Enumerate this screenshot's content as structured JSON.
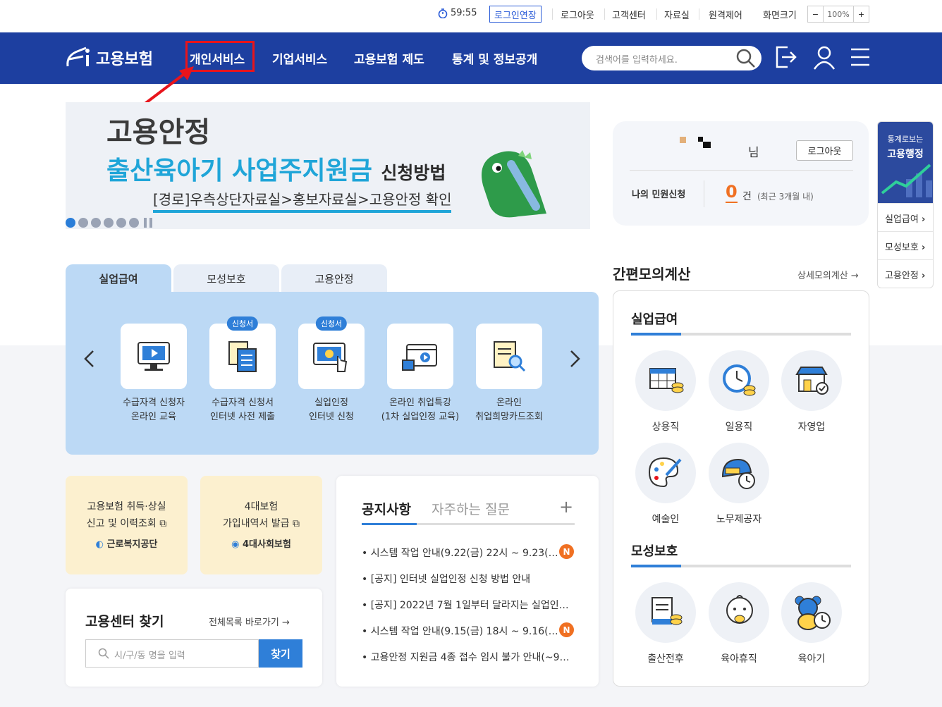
{
  "utility": {
    "timer": "59:55",
    "extend_label": "로그인연장",
    "logout": "로그아웃",
    "customer_center": "고객센터",
    "archive": "자료실",
    "remote": "원격제어",
    "screen_size": "화면크기",
    "zoom_minus": "−",
    "zoom_value": "100%",
    "zoom_plus": "+"
  },
  "header": {
    "logo_text": "고용보험",
    "nav": [
      "개인서비스",
      "기업서비스",
      "고용보험 제도",
      "통계 및 정보공개"
    ],
    "search_placeholder": "검색어를 입력하세요."
  },
  "banner": {
    "line1": "고용안정",
    "line2": "출산육아기 사업주지원금",
    "line2_suffix": "신청방법",
    "line3": "[경로]우측상단자료실>홍보자료실>고용안정 확인"
  },
  "user": {
    "suffix": "님",
    "logout_label": "로그아웃",
    "my_request_label": "나의 민원신청",
    "count": "0",
    "count_unit": "건",
    "count_note": "(최근 3개월 내)"
  },
  "side": {
    "top_small": "통계로보는",
    "top_big": "고용행정",
    "links": [
      "실업급여",
      "모성보호",
      "고용안정"
    ]
  },
  "tabs": [
    "실업급여",
    "모성보호",
    "고용안정"
  ],
  "services": [
    {
      "line1": "수급자격 신청자",
      "line2": "온라인 교육",
      "badge": ""
    },
    {
      "line1": "수급자격 신청서",
      "line2": "인터넷 사전 제출",
      "badge": "신청서"
    },
    {
      "line1": "실업인정",
      "line2": "인터넷 신청",
      "badge": "신청서"
    },
    {
      "line1": "온라인 취업특강",
      "line2": "(1차 실업인정 교육)",
      "badge": ""
    },
    {
      "line1": "온라인",
      "line2": "취업희망카드조회",
      "badge": ""
    }
  ],
  "cards": [
    {
      "line1": "고용보험 취득·상실",
      "line2": "신고 및 이력조회",
      "org": "근로복지공단"
    },
    {
      "line1": "4대보험",
      "line2": "가입내역서 발급",
      "org": "4대사회보험"
    }
  ],
  "finder": {
    "title": "고용센터 찾기",
    "link": "전체목록 바로가기",
    "placeholder": "시/구/동 명을 입력",
    "button": "찾기"
  },
  "notice": {
    "tab_active": "공지사항",
    "tab_other": "자주하는 질문",
    "plus": "+",
    "items": [
      {
        "text": "시스템 작업 안내(9.22(금) 22시 ~ 9.23(…",
        "new": "N"
      },
      {
        "text": "[공지] 인터넷 실업인정 신청 방법 안내",
        "new": ""
      },
      {
        "text": "[공지] 2022년 7월 1일부터 달라지는 실업인…",
        "new": ""
      },
      {
        "text": "시스템 작업 안내(9.15(금) 18시 ~ 9.16(…",
        "new": "N"
      },
      {
        "text": "고용안정 지원금 4종 접수 임시 불가 안내(~9…",
        "new": ""
      }
    ]
  },
  "calc": {
    "title": "간편모의계산",
    "detail_link": "상세모의계산",
    "section1": "실업급여",
    "items1": [
      "상용직",
      "일용직",
      "자영업",
      "예술인",
      "노무제공자"
    ],
    "section2": "모성보호",
    "items2": [
      "출산전후",
      "육아휴직",
      "육아기"
    ]
  },
  "colors": {
    "header_bg": "#1d3fa0",
    "accent": "#2f7fd8",
    "highlight_box": "#e8141b",
    "badge_new": "#f07022"
  }
}
